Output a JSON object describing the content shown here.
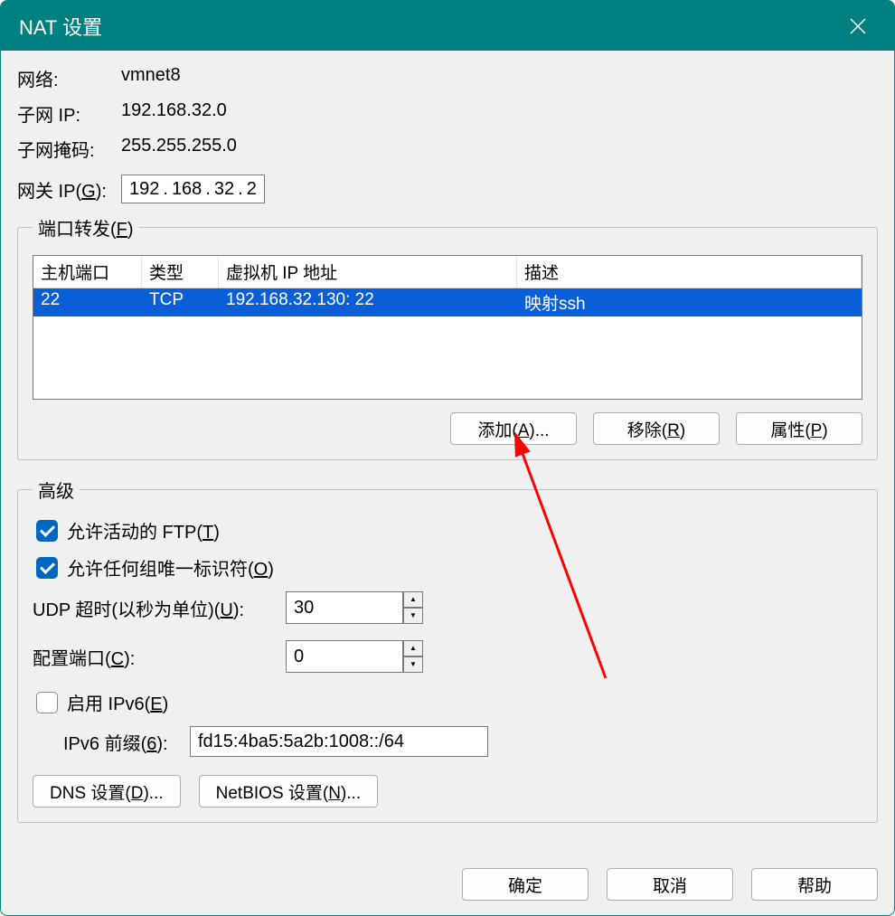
{
  "title": "NAT 设置",
  "info": {
    "network_label": "网络:",
    "network_value": "vmnet8",
    "subnet_ip_label": "子网 IP:",
    "subnet_ip_value": "192.168.32.0",
    "subnet_mask_label": "子网掩码:",
    "subnet_mask_value": "255.255.255.0",
    "gateway_label_pre": "网关 IP(",
    "gateway_hotkey": "G",
    "gateway_label_post": "):",
    "gateway_ip_parts": [
      "192",
      "168",
      "32",
      "2"
    ]
  },
  "port_forward": {
    "legend_pre": "端口转发(",
    "legend_hotkey": "F",
    "legend_post": ")",
    "columns": [
      "主机端口",
      "类型",
      "虚拟机 IP 地址",
      "描述"
    ],
    "rows": [
      {
        "host_port": "22",
        "type": "TCP",
        "vm_ip": "192.168.32.130: 22",
        "desc": "映射ssh",
        "selected": true
      }
    ],
    "buttons": {
      "add_pre": "添加(",
      "add_hot": "A",
      "add_post": ")...",
      "remove_pre": "移除(",
      "remove_hot": "R",
      "remove_post": ")",
      "prop_pre": "属性(",
      "prop_hot": "P",
      "prop_post": ")"
    }
  },
  "advanced": {
    "legend": "高级",
    "ftp_pre": "允许活动的 FTP(",
    "ftp_hot": "T",
    "ftp_post": ")",
    "ftp_checked": true,
    "oui_pre": "允许任何组唯一标识符(",
    "oui_hot": "O",
    "oui_post": ")",
    "oui_checked": true,
    "udp_pre": "UDP 超时(以秒为单位)(",
    "udp_hot": "U",
    "udp_post": "):",
    "udp_value": "30",
    "cfg_pre": "配置端口(",
    "cfg_hot": "C",
    "cfg_post": "):",
    "cfg_value": "0",
    "ipv6_en_pre": "启用 IPv6(",
    "ipv6_en_hot": "E",
    "ipv6_en_post": ")",
    "ipv6_en_checked": false,
    "ipv6_pfx_pre": "IPv6 前缀(",
    "ipv6_pfx_hot": "6",
    "ipv6_pfx_post": "):",
    "ipv6_pfx_value": "fd15:4ba5:5a2b:1008::/64",
    "dns_pre": "DNS 设置(",
    "dns_hot": "D",
    "dns_post": ")...",
    "nb_pre": "NetBIOS 设置(",
    "nb_hot": "N",
    "nb_post": ")..."
  },
  "footer": {
    "ok": "确定",
    "cancel": "取消",
    "help": "帮助"
  }
}
